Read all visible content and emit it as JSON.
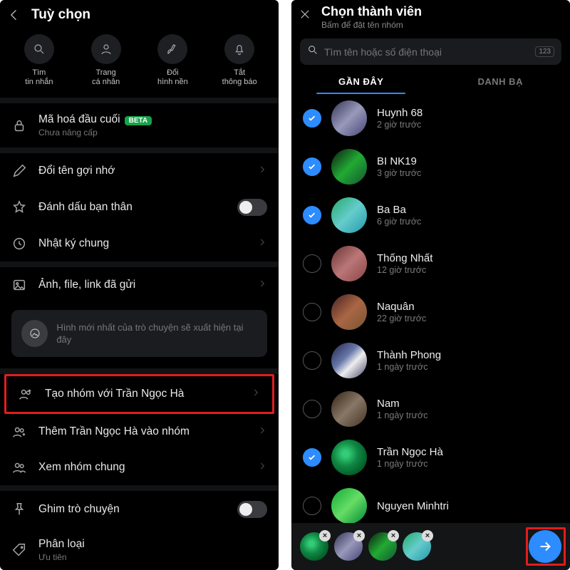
{
  "left": {
    "title": "Tuỳ chọn",
    "quick": [
      {
        "label": "Tìm\ntin nhắn"
      },
      {
        "label": "Trang\ncá nhân"
      },
      {
        "label": "Đổi\nhình nền"
      },
      {
        "label": "Tắt\nthông báo"
      }
    ],
    "e2ee": {
      "label": "Mã hoá đầu cuối",
      "badge": "BETA",
      "sub": "Chưa nâng cấp"
    },
    "rename": "Đổi tên gợi nhớ",
    "bestfriend": "Đánh dấu bạn thân",
    "mutual_diary": "Nhật ký chung",
    "media": "Ảnh, file, link đã gửi",
    "media_note": "Hình mới nhất của trò chuyện sẽ xuất hiện tại đây",
    "create_group": "Tạo nhóm với Trần Ngọc Hà",
    "add_to_group": "Thêm Trần Ngọc Hà vào nhóm",
    "view_common_groups": "Xem nhóm chung",
    "pin": "Ghim trò chuyện",
    "category": {
      "label": "Phân loại",
      "sub": "Ưu tiên"
    }
  },
  "right": {
    "title": "Chọn thành viên",
    "hint": "Bấm để đặt tên nhóm",
    "search_placeholder": "Tìm tên hoặc số điện thoại",
    "kbd": "123",
    "tabs": {
      "recent": "GẦN ĐÂY",
      "contacts": "DANH BẠ"
    },
    "members": [
      {
        "name": "Huynh 68",
        "time": "2 giờ trước",
        "selected": true,
        "av": "av1"
      },
      {
        "name": "BI NK19",
        "time": "3 giờ trước",
        "selected": true,
        "av": "av2"
      },
      {
        "name": "Ba Ba",
        "time": "6 giờ trước",
        "selected": true,
        "av": "av3"
      },
      {
        "name": "Thống Nhất",
        "time": "12 giờ trước",
        "selected": false,
        "av": "av4"
      },
      {
        "name": "Naquân",
        "time": "22 giờ trước",
        "selected": false,
        "av": "av5"
      },
      {
        "name": "Thành Phong",
        "time": "1 ngày trước",
        "selected": false,
        "av": "av6"
      },
      {
        "name": "Nam",
        "time": "1 ngày trước",
        "selected": false,
        "av": "av7"
      },
      {
        "name": "Trần Ngọc Hà",
        "time": "1 ngày trước",
        "selected": true,
        "av": "av8"
      },
      {
        "name": "Nguyen Minhtri",
        "time": "",
        "selected": false,
        "av": "av9"
      }
    ],
    "chips_av": [
      "av8",
      "av1",
      "av2",
      "av3"
    ]
  }
}
